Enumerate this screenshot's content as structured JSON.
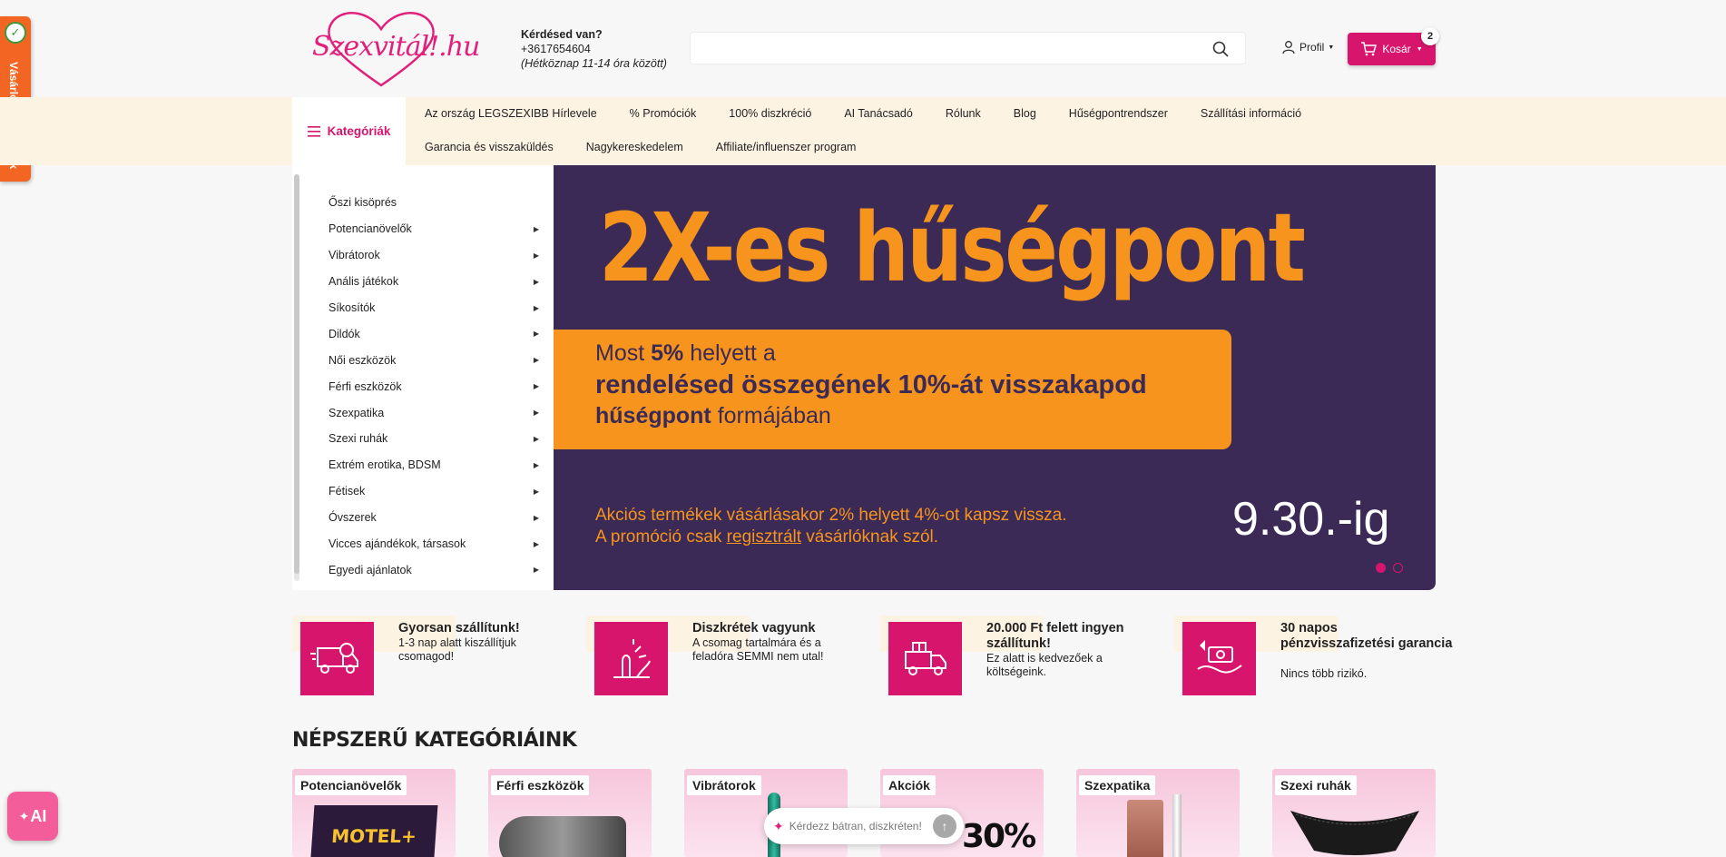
{
  "reviews_tab": {
    "label": "Vásárlói vélemények"
  },
  "header": {
    "logo_text": "Szexvitál!.hu",
    "contact_question": "Kérdésed van?",
    "phone": "+3617654604",
    "hours": "(Hétköznap 11-14 óra között)",
    "search_placeholder": "",
    "profile_label": "Profil",
    "cart_label": "Kosár",
    "cart_count": "2"
  },
  "nav": {
    "categories_button": "Kategóriák",
    "row1": [
      "Az ország LEGSZEXIBB Hírlevele",
      "% Promóciók",
      "100% diszkréció",
      "AI Tanácsadó",
      "Rólunk",
      "Blog",
      "Hűségpontrendszer",
      "Szállítási információ"
    ],
    "row2": [
      "Garancia és visszaküldés",
      "Nagykereskedelem",
      "Affiliate/influenszer program"
    ]
  },
  "categories": [
    {
      "label": "Őszi kisöprés",
      "has_sub": false
    },
    {
      "label": "Potencianövelők",
      "has_sub": true
    },
    {
      "label": "Vibrátorok",
      "has_sub": true
    },
    {
      "label": "Anális játékok",
      "has_sub": true
    },
    {
      "label": "Síkosítók",
      "has_sub": true
    },
    {
      "label": "Dildók",
      "has_sub": true
    },
    {
      "label": "Női eszközök",
      "has_sub": true
    },
    {
      "label": "Férfi eszközök",
      "has_sub": true
    },
    {
      "label": "Szexpatika",
      "has_sub": true
    },
    {
      "label": "Szexi ruhák",
      "has_sub": true
    },
    {
      "label": "Extrém erotika, BDSM",
      "has_sub": true
    },
    {
      "label": "Fétisek",
      "has_sub": true
    },
    {
      "label": "Óvszerek",
      "has_sub": true
    },
    {
      "label": "Vicces ajándékok, társasok",
      "has_sub": true
    },
    {
      "label": "Egyedi ajánlatok",
      "has_sub": true
    }
  ],
  "banner": {
    "headline": "2X-es hűségpont",
    "promo_line1_pre": "Most ",
    "promo_line1_bold": "5%",
    "promo_line1_post": " helyett a",
    "promo_line2": "rendelésed összegének 10%-át visszakapod",
    "promo_line3_bold": "hűségpont",
    "promo_line3_post": " formájában",
    "fine1": "Akciós termékek vásárlásakor 2% helyett 4%-ot kapsz vissza.",
    "fine2_pre": "A promóció csak ",
    "fine2_link": "regisztrált",
    "fine2_post": " vásárlóknak szól.",
    "date": "9.30.-ig",
    "slides": 2,
    "active_slide": 1
  },
  "features": [
    {
      "title": "Gyorsan szállítunk!",
      "desc": "1-3 nap alatt kiszállítjuk csomagod!",
      "icon": "truck-clock-icon"
    },
    {
      "title": "Diszkrétek vagyunk",
      "desc": "A csomag tartalmára és a feladóra SEMMI nem utal!",
      "icon": "discreet-icon"
    },
    {
      "title": "20.000 Ft felett ingyen szállítunk!",
      "desc": "Ez alatt is kedvezőek a költségeink.",
      "icon": "gift-truck-icon"
    },
    {
      "title": "30 napos pénzvisszafizetési garancia",
      "desc": "Nincs több rizikó.",
      "icon": "money-back-icon"
    }
  ],
  "popular": {
    "heading": "NÉPSZERŰ KATEGÓRIÁINK",
    "tiles": [
      "Potencianövelők",
      "Férfi eszközök",
      "Vibrátorok",
      "Akciók",
      "Szexpatika",
      "Szexi ruhák"
    ]
  },
  "chat": {
    "placeholder": "Kérdezz bátran, diszkréten!",
    "ai_label": "AI"
  },
  "colors": {
    "brand": "#d8156c",
    "banner_bg": "#3a2a55",
    "banner_accent": "#f7941d",
    "nav_band": "#fdf3e3"
  }
}
